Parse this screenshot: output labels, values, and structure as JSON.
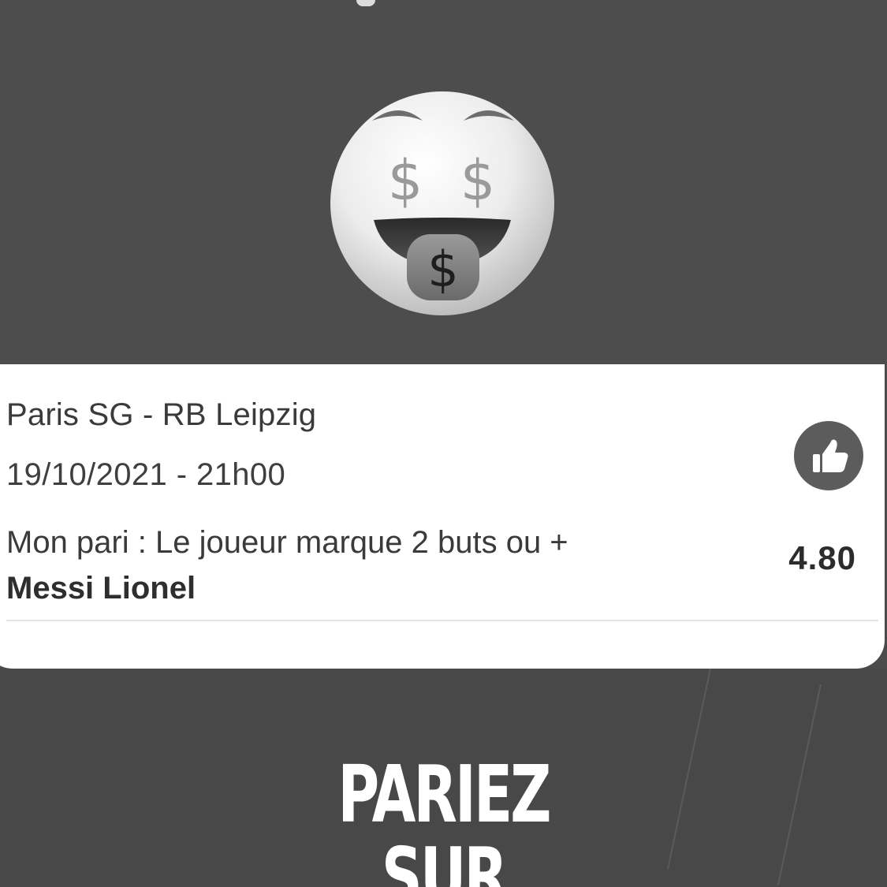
{
  "emoji": {
    "name": "money-mouth-face"
  },
  "bet_card": {
    "match": "Paris SG - RB Leipzig",
    "datetime": "19/10/2021 - 21h00",
    "bet_label": "Mon pari : Le joueur marque 2 buts ou +",
    "player": "Messi Lionel",
    "odds": "4.80",
    "like_icon": "thumbs-up-icon"
  },
  "promo": {
    "line1": "PARIEZ",
    "line2": "SUR"
  },
  "colors": {
    "background": "#4b4b4b",
    "card": "#ffffff",
    "like_button": "#5c5c5c"
  }
}
